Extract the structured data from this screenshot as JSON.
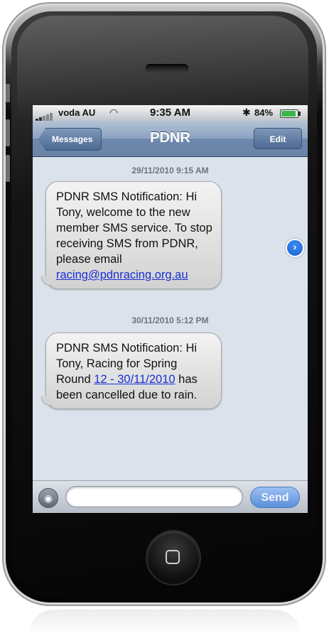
{
  "status_bar": {
    "carrier": "voda AU",
    "time": "9:35 AM",
    "battery": "84%",
    "battery_level": 0.84,
    "signal_icon": "signal-bars-icon",
    "wifi_icon": "wifi-icon",
    "bluetooth_icon": "bluetooth-icon"
  },
  "nav": {
    "back_label": "Messages",
    "title": "PDNR",
    "edit_label": "Edit"
  },
  "conversation": {
    "messages": [
      {
        "timestamp": "29/11/2010 9:15 AM",
        "text_before": "PDNR SMS Notification: Hi Tony, welcome to the new member SMS service. To stop receiving SMS from PDNR, please email ",
        "link": "racing@pdnracing.org.au",
        "text_after": ""
      },
      {
        "timestamp": "30/11/2010 5:12 PM",
        "text_before": "PDNR SMS Notification: Hi Tony, Racing for Spring Round ",
        "link": "12 - 30/11/2010",
        "text_after": " has been cancelled due to rain."
      }
    ],
    "detail_icon": "chevron-right-circle-icon"
  },
  "input_bar": {
    "camera_icon": "camera-icon",
    "placeholder": "",
    "send_label": "Send"
  },
  "device": {
    "home_icon": "home-button-icon"
  }
}
